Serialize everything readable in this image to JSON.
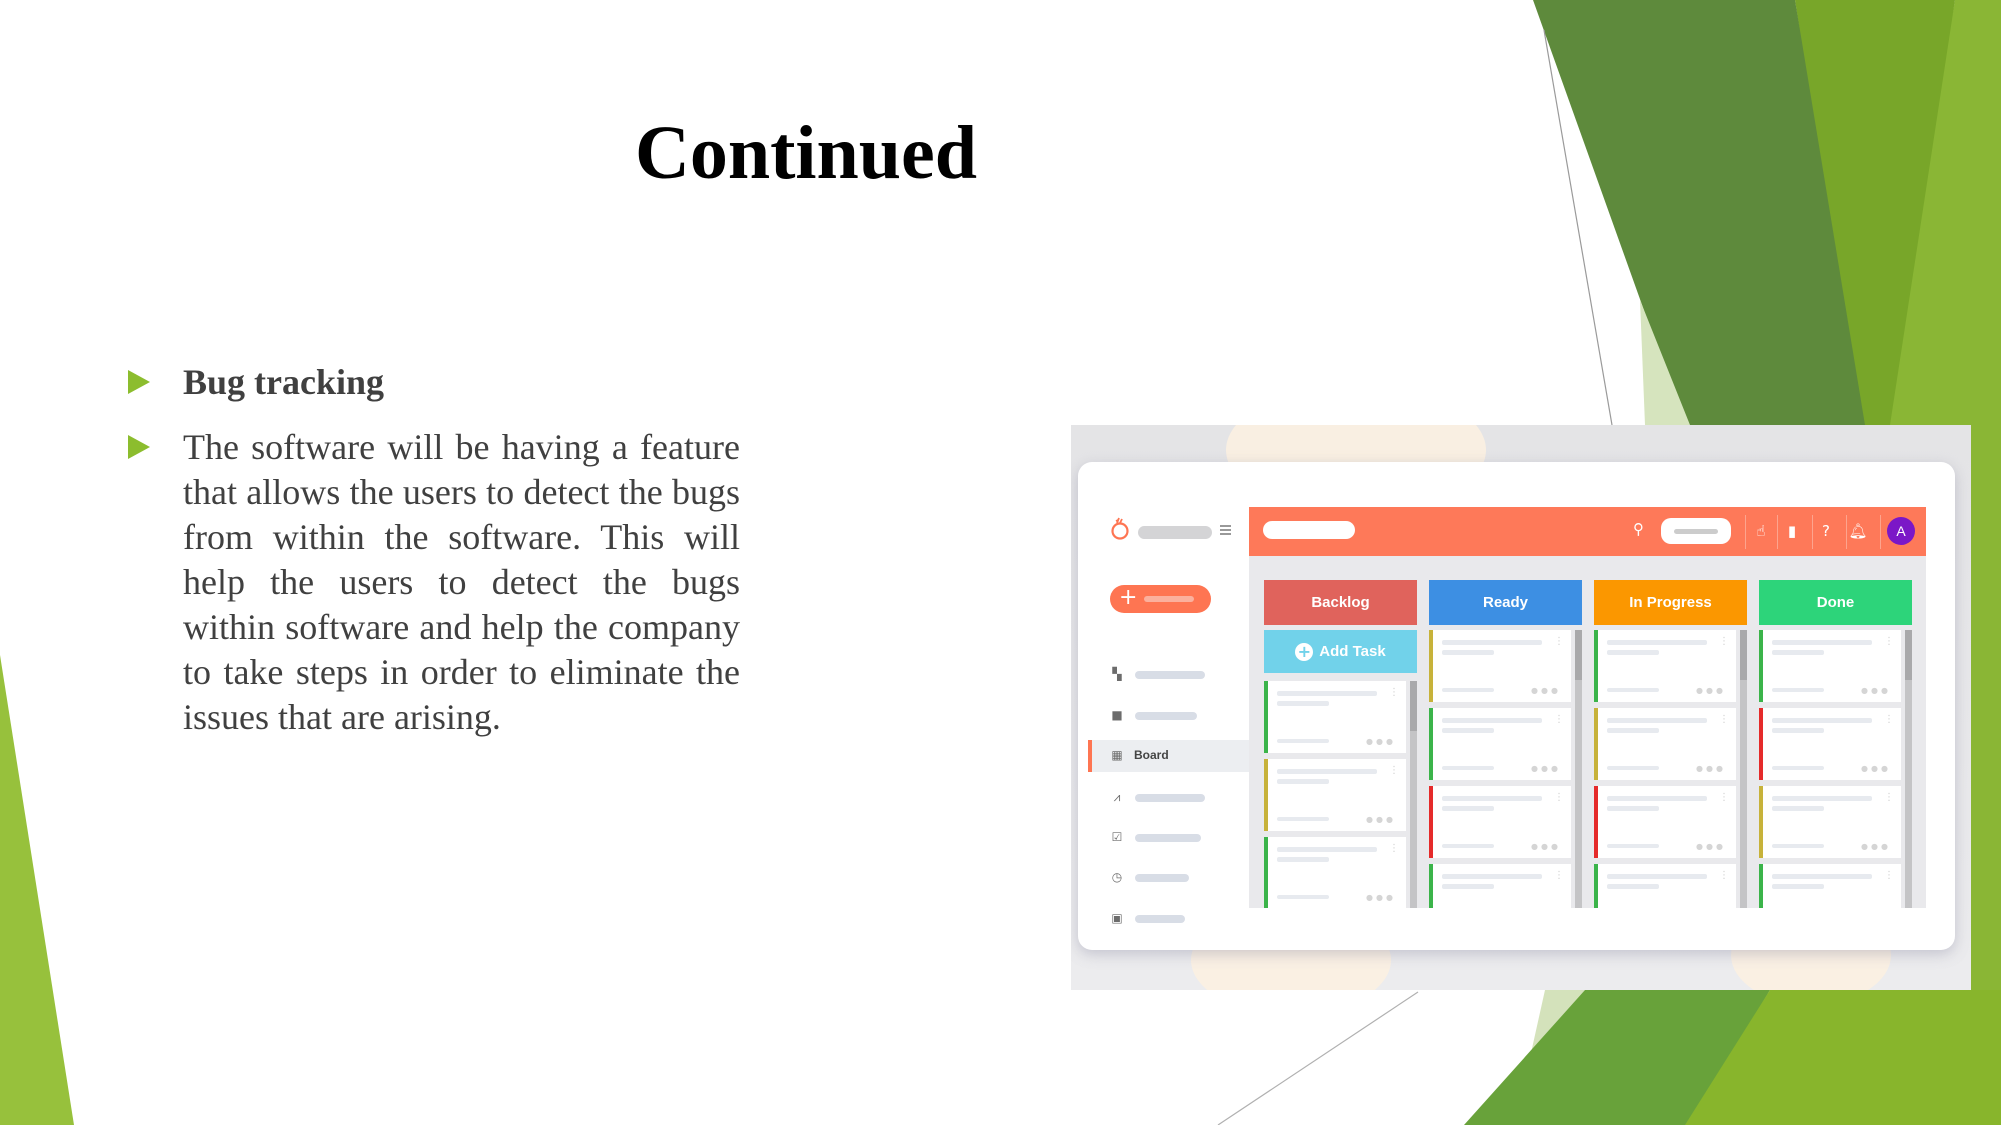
{
  "slide": {
    "title": "Continued",
    "bullets": [
      "Bug tracking",
      "The software will be having a feature that allows the users to detect the bugs from within the software. This will help the users to detect the bugs within software and help the company to take steps in order to eliminate the issues that are arising."
    ]
  },
  "theme": {
    "accent_green": "#8cbd2e",
    "dark_green": "#5e8a3c",
    "text_color": "#404040"
  },
  "app_screenshot": {
    "header": {
      "search_icon": "search-icon",
      "icons": [
        "pointer-icon",
        "feedback-icon",
        "help-icon",
        "bell-icon"
      ],
      "avatar_initial": "A",
      "avatar_color": "#7b17c7",
      "header_color": "#fe7959"
    },
    "sidebar": {
      "logo_icon": "tomato-logo-icon",
      "new_button_icon": "plus-icon",
      "items": [
        {
          "icon": "dashboard-icon",
          "label": ""
        },
        {
          "icon": "briefcase-icon",
          "label": ""
        },
        {
          "icon": "board-icon",
          "label": "Board",
          "active": true
        },
        {
          "icon": "activity-icon",
          "label": ""
        },
        {
          "icon": "clipboard-icon",
          "label": ""
        },
        {
          "icon": "clock-icon",
          "label": ""
        },
        {
          "icon": "contact-icon",
          "label": ""
        }
      ]
    },
    "board": {
      "add_task_label": "Add Task",
      "columns": [
        {
          "name": "Backlog",
          "color": "#e0635c",
          "cards": [
            "#3bb44a",
            "#c7b23a",
            "#3bb44a"
          ]
        },
        {
          "name": "Ready",
          "color": "#3d8fe3",
          "cards": [
            "#c7b23a",
            "#3bb44a",
            "#e52a2a",
            "#3bb44a"
          ]
        },
        {
          "name": "In Progress",
          "color": "#fb9700",
          "cards": [
            "#3bb44a",
            "#c7b23a",
            "#e52a2a",
            "#3bb44a"
          ]
        },
        {
          "name": "Done",
          "color": "#2dd47a",
          "cards": [
            "#3bb44a",
            "#e52a2a",
            "#c7b23a",
            "#3bb44a"
          ]
        }
      ]
    }
  }
}
